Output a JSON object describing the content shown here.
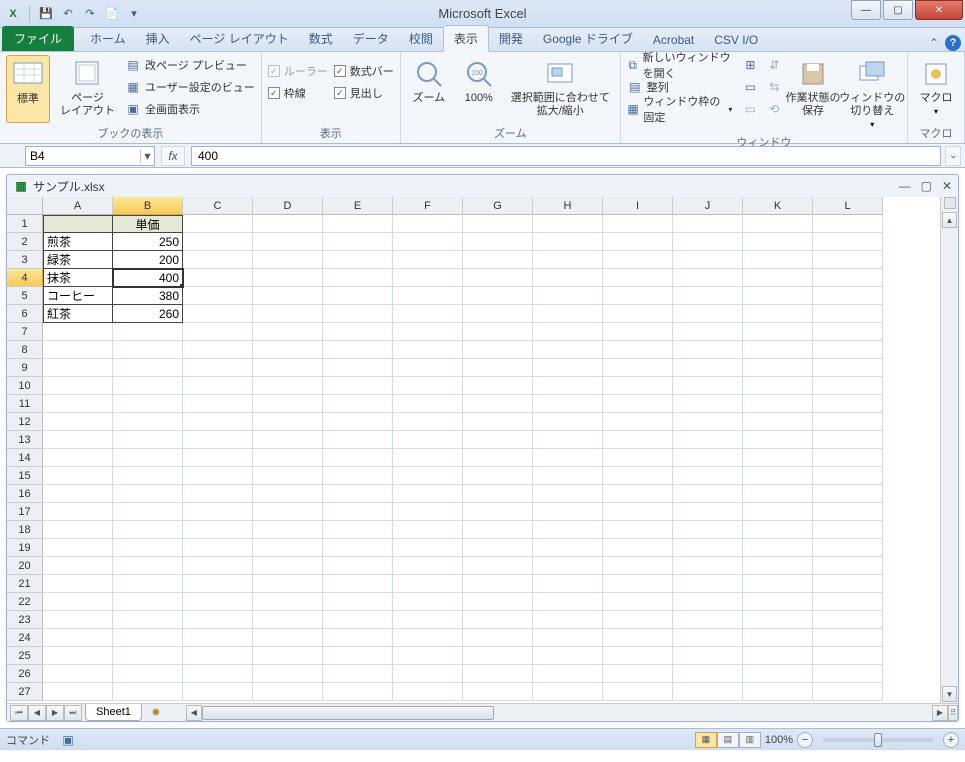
{
  "app": {
    "title": "Microsoft Excel"
  },
  "qat": {
    "save": "💾",
    "undo": "↶",
    "redo": "↷",
    "new": "📄"
  },
  "tabs": {
    "file": "ファイル",
    "items": [
      "ホーム",
      "挿入",
      "ページ レイアウト",
      "数式",
      "データ",
      "校閲",
      "表示",
      "開発",
      "Google ドライブ",
      "Acrobat",
      "CSV I/O"
    ],
    "active": "表示"
  },
  "ribbon": {
    "book_view": {
      "normal": "標準",
      "page_layout": "ページ\nレイアウト",
      "page_break": "改ページ プレビュー",
      "custom_view": "ユーザー設定のビュー",
      "fullscreen": "全画面表示",
      "label": "ブックの表示"
    },
    "show": {
      "ruler": "ルーラー",
      "formula_bar": "数式バー",
      "gridlines": "枠線",
      "headings": "見出し",
      "label": "表示"
    },
    "zoom": {
      "zoom": "ズーム",
      "p100": "100%",
      "selection": "選択範囲に合わせて\n拡大/縮小",
      "label": "ズーム"
    },
    "window": {
      "new_window": "新しいウィンドウを開く",
      "arrange": "整列",
      "freeze": "ウィンドウ枠の固定",
      "save_ws": "作業状態の\n保存",
      "switch": "ウィンドウの\n切り替え",
      "label": "ウィンドウ"
    },
    "macro": {
      "macro": "マクロ",
      "label": "マクロ"
    }
  },
  "namebox": "B4",
  "formula": "400",
  "workbook": {
    "filename": "サンプル.xlsx",
    "columns": [
      "A",
      "B",
      "C",
      "D",
      "E",
      "F",
      "G",
      "H",
      "I",
      "J",
      "K",
      "L"
    ],
    "selected_col": "B",
    "selected_row": 4,
    "row_nums": [
      1,
      2,
      3,
      4,
      5,
      6,
      7,
      8,
      9,
      10,
      11,
      12,
      13,
      14,
      15,
      16,
      17,
      18,
      19,
      20,
      21,
      22,
      23,
      24,
      25,
      26,
      27
    ],
    "data": {
      "header_b1": "単価",
      "a2": "煎茶",
      "b2": "250",
      "a3": "緑茶",
      "b3": "200",
      "a4": "抹茶",
      "b4": "400",
      "a5": "コーヒー",
      "b5": "380",
      "a6": "紅茶",
      "b6": "260"
    },
    "sheet": "Sheet1"
  },
  "status": {
    "mode": "コマンド",
    "zoom": "100%"
  }
}
